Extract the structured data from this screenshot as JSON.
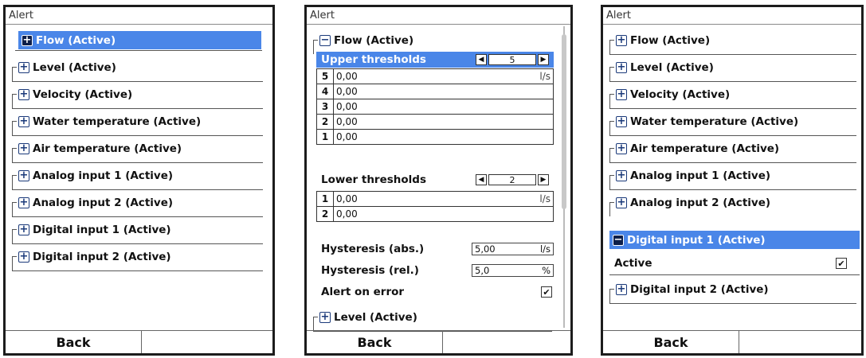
{
  "title": "Alert",
  "back_label": "Back",
  "screen1": {
    "items": [
      {
        "label": "Flow (Active)",
        "icon": "+"
      },
      {
        "label": "Level (Active)",
        "icon": "+"
      },
      {
        "label": "Velocity (Active)",
        "icon": "+"
      },
      {
        "label": "Water temperature (Active)",
        "icon": "+"
      },
      {
        "label": "Air temperature (Active)",
        "icon": "+"
      },
      {
        "label": "Analog input 1 (Active)",
        "icon": "+"
      },
      {
        "label": "Analog input 2 (Active)",
        "icon": "+"
      },
      {
        "label": "Digital input 1 (Active)",
        "icon": "+"
      },
      {
        "label": "Digital input 2 (Active)",
        "icon": "+"
      }
    ]
  },
  "screen2": {
    "flow_label": "Flow (Active)",
    "flow_icon": "−",
    "upper_label": "Upper thresholds",
    "upper_count": "5",
    "upper_rows": [
      {
        "n": "5",
        "v": "0,00",
        "u": "l/s"
      },
      {
        "n": "4",
        "v": "0,00",
        "u": ""
      },
      {
        "n": "3",
        "v": "0,00",
        "u": ""
      },
      {
        "n": "2",
        "v": "0,00",
        "u": ""
      },
      {
        "n": "1",
        "v": "0,00",
        "u": ""
      }
    ],
    "lower_label": "Lower thresholds",
    "lower_count": "2",
    "lower_rows": [
      {
        "n": "1",
        "v": "0,00",
        "u": "l/s"
      },
      {
        "n": "2",
        "v": "0,00",
        "u": ""
      }
    ],
    "hyst_abs_label": "Hysteresis (abs.)",
    "hyst_abs_value": "5,00",
    "hyst_abs_unit": "l/s",
    "hyst_rel_label": "Hysteresis (rel.)",
    "hyst_rel_value": "5,0",
    "hyst_rel_unit": "%",
    "alert_error_label": "Alert on error",
    "alert_error_checked": "✔",
    "level_label": "Level (Active)",
    "level_icon": "+",
    "left_arrow": "◀",
    "right_arrow": "▶"
  },
  "screen3": {
    "items": [
      {
        "label": "Flow (Active)",
        "icon": "+"
      },
      {
        "label": "Level (Active)",
        "icon": "+"
      },
      {
        "label": "Velocity (Active)",
        "icon": "+"
      },
      {
        "label": "Water temperature (Active)",
        "icon": "+"
      },
      {
        "label": "Air temperature (Active)",
        "icon": "+"
      },
      {
        "label": "Analog input 1 (Active)",
        "icon": "+"
      },
      {
        "label": "Analog input 2 (Active)",
        "icon": "+"
      }
    ],
    "digital1_label": "Digital input 1 (Active)",
    "digital1_icon": "−",
    "active_label": "Active",
    "active_checked": "✔",
    "digital2_label": "Digital input 2 (Active)",
    "digital2_icon": "+"
  },
  "colors": {
    "selected": "#4a86e8",
    "icon_dark": "#0d1f4a"
  }
}
